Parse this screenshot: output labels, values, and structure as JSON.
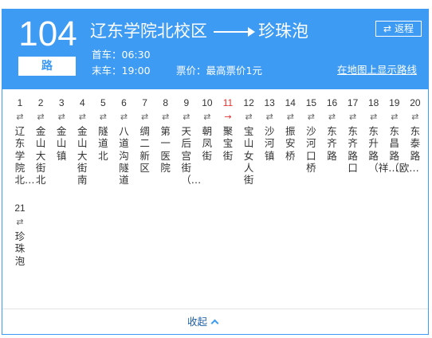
{
  "header": {
    "route_number": "104",
    "route_suffix": "路",
    "origin": "辽东学院北校区",
    "destination": "珍珠泡",
    "reverse_label": "返程",
    "first_bus": "首车：06:30",
    "last_bus": "末车：19:00",
    "fare": "票价：最高票价1元",
    "map_link": "在地图上显示路线"
  },
  "stops": [
    {
      "num": "1",
      "name": "辽东学院北…",
      "current": false
    },
    {
      "num": "2",
      "name": "金山大街北",
      "current": false
    },
    {
      "num": "3",
      "name": "金山镇",
      "current": false
    },
    {
      "num": "4",
      "name": "金山大街南",
      "current": false
    },
    {
      "num": "5",
      "name": "隧道北",
      "current": false
    },
    {
      "num": "6",
      "name": "八道沟隧道",
      "current": false
    },
    {
      "num": "7",
      "name": "绸二新区",
      "current": false
    },
    {
      "num": "8",
      "name": "第一医院",
      "current": false
    },
    {
      "num": "9",
      "name": "天后宫街（…",
      "current": false
    },
    {
      "num": "10",
      "name": "朝凤街",
      "current": false
    },
    {
      "num": "11",
      "name": "聚宝街",
      "current": true
    },
    {
      "num": "12",
      "name": "宝山女人街",
      "current": false
    },
    {
      "num": "13",
      "name": "沙河镇",
      "current": false
    },
    {
      "num": "14",
      "name": "振安桥",
      "current": false
    },
    {
      "num": "15",
      "name": "沙河口桥",
      "current": false
    },
    {
      "num": "16",
      "name": "东齐路",
      "current": false
    },
    {
      "num": "17",
      "name": "东齐路口",
      "current": false
    },
    {
      "num": "18",
      "name": "东升路（祥…",
      "current": false
    },
    {
      "num": "19",
      "name": "东昌路（欧…",
      "current": false
    },
    {
      "num": "20",
      "name": "东泰路",
      "current": false
    },
    {
      "num": "21",
      "name": "珍珠泡",
      "current": false
    }
  ],
  "collapse_label": "收起",
  "colors": {
    "accent": "#3d9bf4",
    "current_stop": "#e23131",
    "link": "#1d5fa8"
  },
  "icons": {
    "direction": "two-way-arrow-icon",
    "current_direction": "right-arrow-icon",
    "collapse": "chevron-up-icon"
  }
}
